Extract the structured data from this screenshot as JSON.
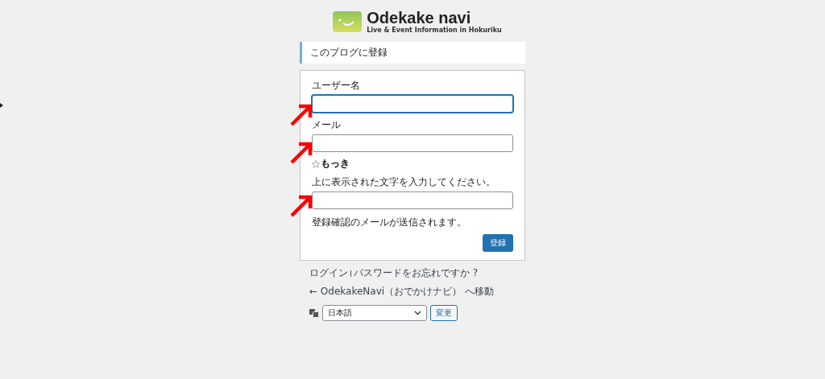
{
  "logo": {
    "name": "Odekake navi",
    "tagline": "Live & Event Information in Hokuriku"
  },
  "notice": "このブログに登録",
  "form": {
    "fields": [
      {
        "label": "ユーザー名",
        "focused": true
      },
      {
        "label": "メール",
        "focused": false
      }
    ],
    "captcha": {
      "text": "もっき",
      "instruction": "上に表示された文字を入力してください。"
    },
    "note": "登録確認のメールが送信されます。",
    "submit": "登録"
  },
  "links": [
    {
      "text": "ログイン"
    },
    {
      "text": "パスワードをお忘れですか ?"
    }
  ],
  "back_link": "← OdekakeNavi（おでかけナビ） へ移動",
  "language": {
    "value": "日本語",
    "button": "変更"
  }
}
